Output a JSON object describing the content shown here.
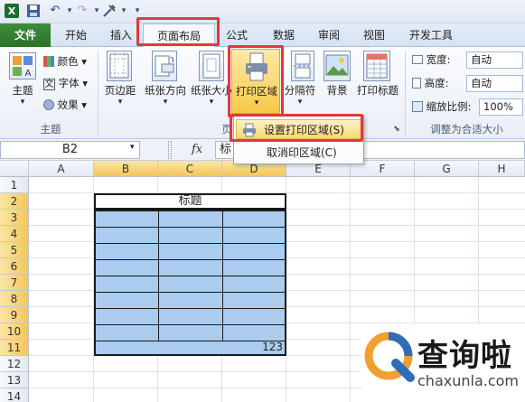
{
  "qat": {
    "undo_icon": "undo-icon",
    "redo_icon": "redo-icon"
  },
  "tabs": [
    {
      "label": "文件"
    },
    {
      "label": "开始"
    },
    {
      "label": "插入"
    },
    {
      "label": "页面布局"
    },
    {
      "label": "公式"
    },
    {
      "label": "数据"
    },
    {
      "label": "审阅"
    },
    {
      "label": "视图"
    },
    {
      "label": "开发工具"
    }
  ],
  "ribbon": {
    "theme": {
      "main_label": "主题",
      "colors": "颜色",
      "fonts": "字体",
      "effects": "效果",
      "group": "主题"
    },
    "page_setup": {
      "margins": "页边距",
      "orientation": "纸张方向",
      "size": "纸张大小",
      "print_area": "打印区域",
      "breaks": "分隔符",
      "background": "背景",
      "print_titles": "打印标题",
      "group_tail": "页"
    },
    "scale": {
      "width_label": "宽度:",
      "width_value": "自动",
      "height_label": "高度:",
      "height_value": "自动",
      "zoom_label": "缩放比例:",
      "zoom_value": "100%",
      "group": "调整为合适大小"
    }
  },
  "formula_bar": {
    "name_box": "B2",
    "fx": "fx",
    "content": "标"
  },
  "columns": [
    "A",
    "B",
    "C",
    "D",
    "E",
    "F",
    "G",
    "H"
  ],
  "rows": [
    "1",
    "2",
    "3",
    "4",
    "5",
    "6",
    "7",
    "8",
    "9",
    "10",
    "11",
    "12",
    "13",
    "14"
  ],
  "sheet": {
    "title_cell": "标题",
    "value_cell": "123"
  },
  "dropdown": {
    "set_print_area": "设置打印区域(S)",
    "clear_print_area": "取消印区域(C)"
  },
  "watermark": {
    "brand": "查询啦",
    "url": "chaxunla.com"
  },
  "colors": {
    "accent": "#e03a3a",
    "file_tab": "#2a7327",
    "selection_fill": "#a9ccef",
    "header_selected": "#f4c65b"
  }
}
